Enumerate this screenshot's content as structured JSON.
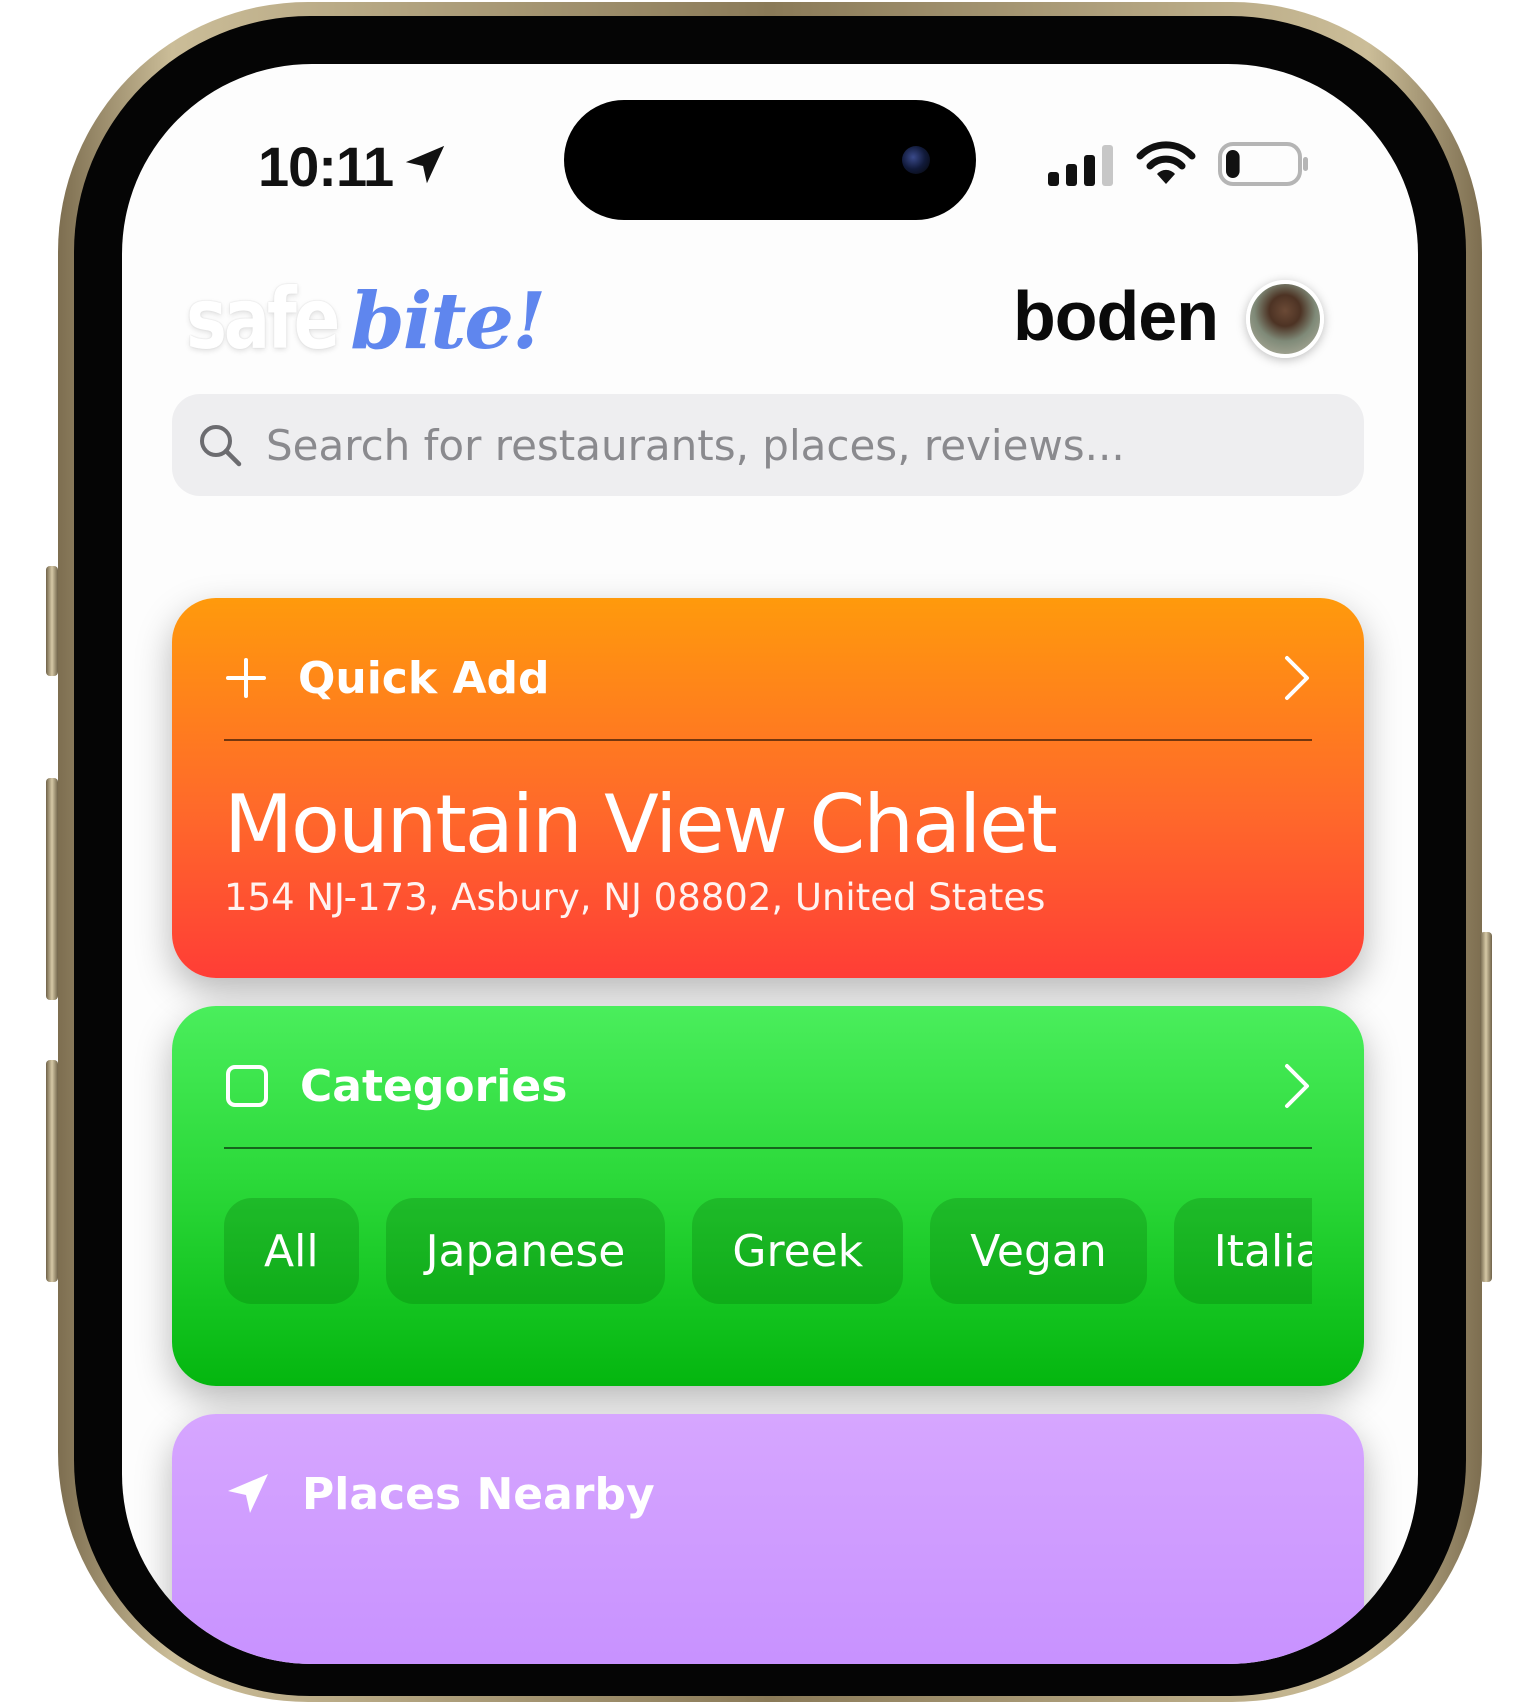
{
  "status_bar": {
    "time": "10:11",
    "location_icon": "location-arrow-icon",
    "signal_icon": "cellular-signal-icon",
    "wifi_icon": "wifi-icon",
    "battery_icon": "battery-icon",
    "battery_level": 0.2
  },
  "header": {
    "logo_part1": "safe",
    "logo_part2": "bite!",
    "username": "boden",
    "avatar_icon": "avatar"
  },
  "search": {
    "placeholder": "Search for restaurants, places, reviews...",
    "icon": "search-icon"
  },
  "quick_add": {
    "title": "Quick Add",
    "icon": "plus-icon",
    "place_name": "Mountain View Chalet",
    "place_address": "154 NJ-173, Asbury, NJ 08802, United States",
    "colors": {
      "top": "#ff9a0c",
      "bottom": "#ff3d36"
    }
  },
  "categories": {
    "title": "Categories",
    "icon": "square-icon",
    "chips": [
      "All",
      "Japanese",
      "Greek",
      "Vegan",
      "Italia"
    ],
    "colors": {
      "top": "#4aee5c",
      "bottom": "#04b60f"
    }
  },
  "places_nearby": {
    "title": "Places Nearby",
    "icon": "location-arrow-icon",
    "colors": {
      "top": "#d6a6ff",
      "bottom": "#c48cff"
    }
  },
  "accent_colors": {
    "logo_blue": "#5f86ee",
    "phone_gold": "#cbbd98"
  }
}
